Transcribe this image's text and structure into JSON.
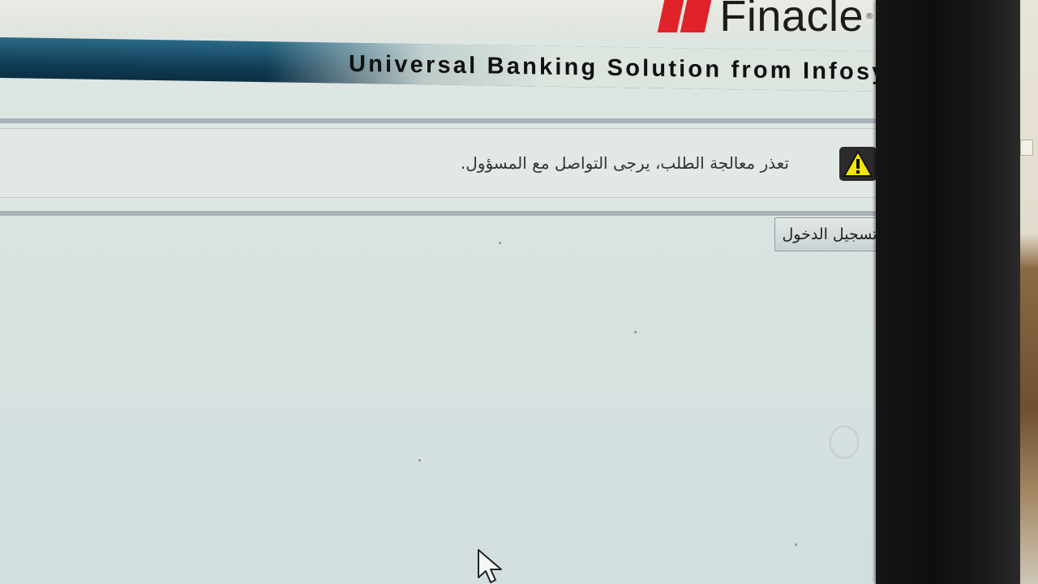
{
  "header": {
    "brand": "Finacle",
    "tagline": "Universal Banking Solution from Infosys"
  },
  "alert": {
    "icon": "warning-icon",
    "message": "تعذر معالجة الطلب، يرجى التواصل مع المسؤول."
  },
  "actions": {
    "login_label": "تسجيل الدخول"
  },
  "colors": {
    "brand_red": "#e0232a",
    "banner_blue": "#1f5570",
    "warning_yellow": "#f3e600"
  }
}
